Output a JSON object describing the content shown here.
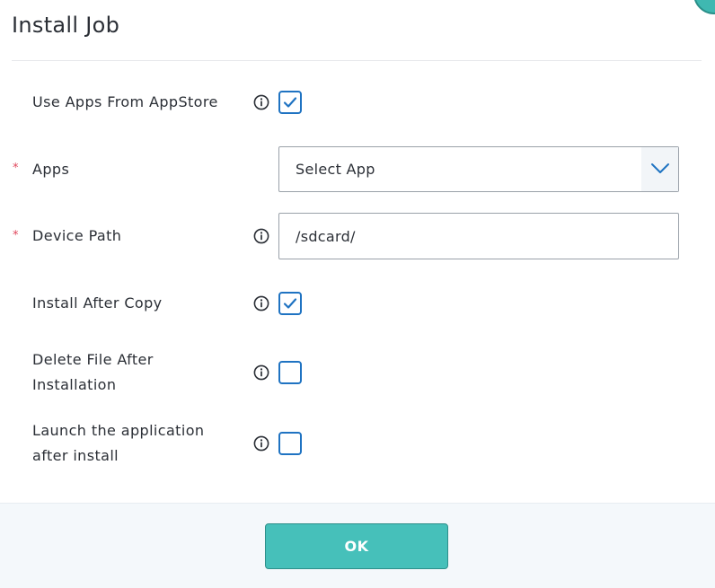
{
  "dialog": {
    "title": "Install Job",
    "ok_label": "OK"
  },
  "fields": {
    "use_appstore": {
      "label": "Use Apps From AppStore",
      "checked": true
    },
    "apps": {
      "label": "Apps",
      "required": true,
      "selected_value": "Select App"
    },
    "device_path": {
      "label": "Device Path",
      "required": true,
      "value": "/sdcard/"
    },
    "install_after_copy": {
      "label": "Install After Copy",
      "checked": true
    },
    "delete_after_install": {
      "label_line1": "Delete File After",
      "label_line2": "Installation",
      "checked": false
    },
    "launch_after_install": {
      "label_line1": "Launch the application",
      "label_line2": "after install",
      "checked": false
    }
  },
  "icons": {
    "info": "info-circle-icon",
    "check": "checkmark-icon",
    "dropdown": "chevron-down-icon",
    "required": "asterisk-icon"
  },
  "colors": {
    "accent": "#46c0ba",
    "checkbox": "#1f73c2",
    "required": "#e0465b"
  },
  "required_marker": "*"
}
